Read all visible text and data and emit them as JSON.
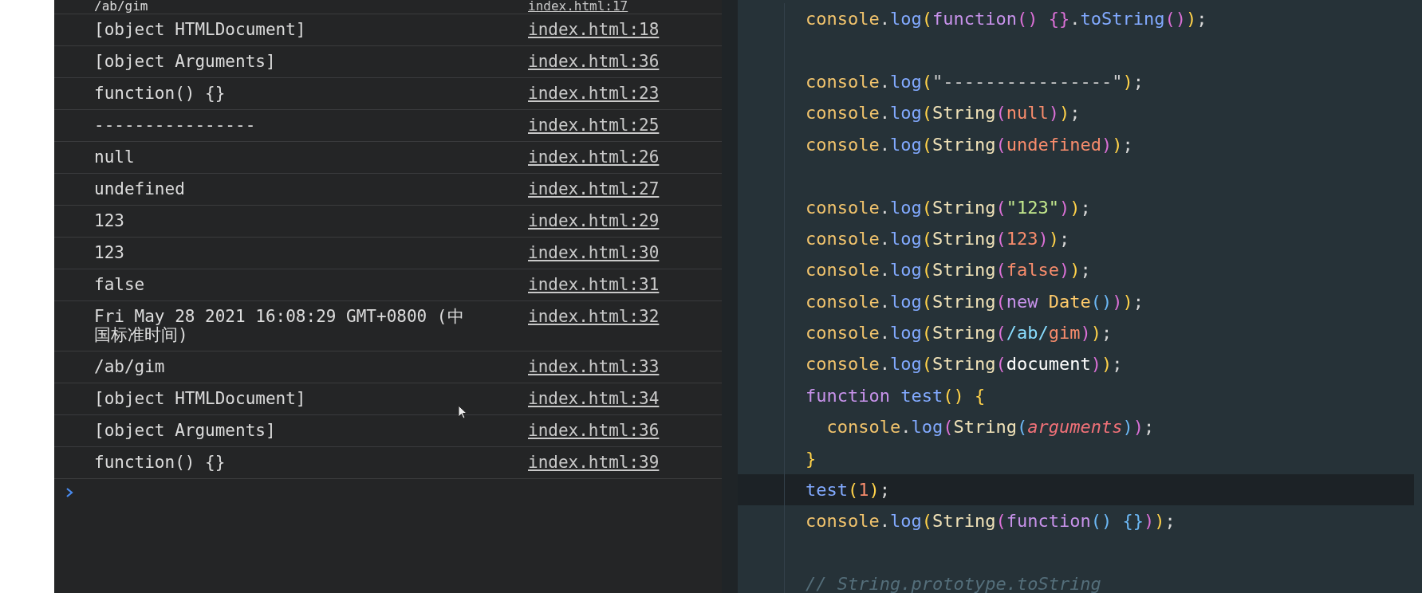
{
  "console": {
    "rows": [
      {
        "message": "/ab/gim",
        "source": "index.html:17"
      },
      {
        "message": "[object HTMLDocument]",
        "source": "index.html:18"
      },
      {
        "message": "[object Arguments]",
        "source": "index.html:36"
      },
      {
        "message": "function() {}",
        "source": "index.html:23"
      },
      {
        "message": "----------------",
        "source": "index.html:25"
      },
      {
        "message": "null",
        "source": "index.html:26"
      },
      {
        "message": "undefined",
        "source": "index.html:27"
      },
      {
        "message": "123",
        "source": "index.html:29"
      },
      {
        "message": "123",
        "source": "index.html:30"
      },
      {
        "message": "false",
        "source": "index.html:31"
      },
      {
        "message": "Fri May 28 2021 16:08:29 GMT+0800 (中国标准时间)",
        "source": "index.html:32"
      },
      {
        "message": "/ab/gim",
        "source": "index.html:33"
      },
      {
        "message": "[object HTMLDocument]",
        "source": "index.html:34"
      },
      {
        "message": "[object Arguments]",
        "source": "index.html:36"
      },
      {
        "message": "function() {}",
        "source": "index.html:39"
      }
    ]
  },
  "editor": {
    "lines": [
      {
        "kind": "code",
        "current": false,
        "tokens": [
          {
            "text": "console",
            "kind": "object"
          },
          {
            "text": ".",
            "kind": "punct"
          },
          {
            "text": "log",
            "kind": "method"
          },
          {
            "text": "(",
            "kind": "paren-gold"
          },
          {
            "text": "function",
            "kind": "keyword"
          },
          {
            "text": "()",
            "kind": "paren-pink"
          },
          {
            "text": " {}",
            "kind": "paren-pink"
          },
          {
            "text": ".",
            "kind": "punct"
          },
          {
            "text": "toString",
            "kind": "method"
          },
          {
            "text": "()",
            "kind": "paren-pink"
          },
          {
            "text": ")",
            "kind": "paren-gold"
          },
          {
            "text": ";",
            "kind": "punct"
          }
        ]
      },
      {
        "kind": "blank",
        "current": false
      },
      {
        "kind": "code",
        "current": false,
        "tokens": [
          {
            "text": "console",
            "kind": "object"
          },
          {
            "text": ".",
            "kind": "punct"
          },
          {
            "text": "log",
            "kind": "method"
          },
          {
            "text": "(",
            "kind": "paren-gold"
          },
          {
            "text": "\"----------------\"",
            "kind": "string"
          },
          {
            "text": ")",
            "kind": "paren-gold"
          },
          {
            "text": ";",
            "kind": "punct"
          }
        ]
      },
      {
        "kind": "code",
        "current": false,
        "tokens": [
          {
            "text": "console",
            "kind": "object"
          },
          {
            "text": ".",
            "kind": "punct"
          },
          {
            "text": "log",
            "kind": "method"
          },
          {
            "text": "(",
            "kind": "paren-gold"
          },
          {
            "text": "String",
            "kind": "builtin"
          },
          {
            "text": "(",
            "kind": "paren-pink"
          },
          {
            "text": "null",
            "kind": "literal"
          },
          {
            "text": ")",
            "kind": "paren-pink"
          },
          {
            "text": ")",
            "kind": "paren-gold"
          },
          {
            "text": ";",
            "kind": "punct"
          }
        ]
      },
      {
        "kind": "code",
        "current": false,
        "tokens": [
          {
            "text": "console",
            "kind": "object"
          },
          {
            "text": ".",
            "kind": "punct"
          },
          {
            "text": "log",
            "kind": "method"
          },
          {
            "text": "(",
            "kind": "paren-gold"
          },
          {
            "text": "String",
            "kind": "builtin"
          },
          {
            "text": "(",
            "kind": "paren-pink"
          },
          {
            "text": "undefined",
            "kind": "literal"
          },
          {
            "text": ")",
            "kind": "paren-pink"
          },
          {
            "text": ")",
            "kind": "paren-gold"
          },
          {
            "text": ";",
            "kind": "punct"
          }
        ]
      },
      {
        "kind": "blank",
        "current": false
      },
      {
        "kind": "code",
        "current": false,
        "tokens": [
          {
            "text": "console",
            "kind": "object"
          },
          {
            "text": ".",
            "kind": "punct"
          },
          {
            "text": "log",
            "kind": "method"
          },
          {
            "text": "(",
            "kind": "paren-gold"
          },
          {
            "text": "String",
            "kind": "builtin"
          },
          {
            "text": "(",
            "kind": "paren-pink"
          },
          {
            "text": "\"123\"",
            "kind": "string-green"
          },
          {
            "text": ")",
            "kind": "paren-pink"
          },
          {
            "text": ")",
            "kind": "paren-gold"
          },
          {
            "text": ";",
            "kind": "punct"
          }
        ]
      },
      {
        "kind": "code",
        "current": false,
        "tokens": [
          {
            "text": "console",
            "kind": "object"
          },
          {
            "text": ".",
            "kind": "punct"
          },
          {
            "text": "log",
            "kind": "method"
          },
          {
            "text": "(",
            "kind": "paren-gold"
          },
          {
            "text": "String",
            "kind": "builtin"
          },
          {
            "text": "(",
            "kind": "paren-pink"
          },
          {
            "text": "123",
            "kind": "literal"
          },
          {
            "text": ")",
            "kind": "paren-pink"
          },
          {
            "text": ")",
            "kind": "paren-gold"
          },
          {
            "text": ";",
            "kind": "punct"
          }
        ]
      },
      {
        "kind": "code",
        "current": false,
        "tokens": [
          {
            "text": "console",
            "kind": "object"
          },
          {
            "text": ".",
            "kind": "punct"
          },
          {
            "text": "log",
            "kind": "method"
          },
          {
            "text": "(",
            "kind": "paren-gold"
          },
          {
            "text": "String",
            "kind": "builtin"
          },
          {
            "text": "(",
            "kind": "paren-pink"
          },
          {
            "text": "false",
            "kind": "literal"
          },
          {
            "text": ")",
            "kind": "paren-pink"
          },
          {
            "text": ")",
            "kind": "paren-gold"
          },
          {
            "text": ";",
            "kind": "punct"
          }
        ]
      },
      {
        "kind": "code",
        "current": false,
        "tokens": [
          {
            "text": "console",
            "kind": "object"
          },
          {
            "text": ".",
            "kind": "punct"
          },
          {
            "text": "log",
            "kind": "method"
          },
          {
            "text": "(",
            "kind": "paren-gold"
          },
          {
            "text": "String",
            "kind": "builtin"
          },
          {
            "text": "(",
            "kind": "paren-pink"
          },
          {
            "text": "new",
            "kind": "keyword"
          },
          {
            "text": " Date",
            "kind": "class"
          },
          {
            "text": "()",
            "kind": "paren-blue"
          },
          {
            "text": ")",
            "kind": "paren-pink"
          },
          {
            "text": ")",
            "kind": "paren-gold"
          },
          {
            "text": ";",
            "kind": "punct"
          }
        ]
      },
      {
        "kind": "code",
        "current": false,
        "tokens": [
          {
            "text": "console",
            "kind": "object"
          },
          {
            "text": ".",
            "kind": "punct"
          },
          {
            "text": "log",
            "kind": "method"
          },
          {
            "text": "(",
            "kind": "paren-gold"
          },
          {
            "text": "String",
            "kind": "builtin"
          },
          {
            "text": "(",
            "kind": "paren-pink"
          },
          {
            "text": "/ab/",
            "kind": "regex"
          },
          {
            "text": "gim",
            "kind": "literal"
          },
          {
            "text": ")",
            "kind": "paren-pink"
          },
          {
            "text": ")",
            "kind": "paren-gold"
          },
          {
            "text": ";",
            "kind": "punct"
          }
        ]
      },
      {
        "kind": "code",
        "current": false,
        "tokens": [
          {
            "text": "console",
            "kind": "object"
          },
          {
            "text": ".",
            "kind": "punct"
          },
          {
            "text": "log",
            "kind": "method"
          },
          {
            "text": "(",
            "kind": "paren-gold"
          },
          {
            "text": "String",
            "kind": "builtin"
          },
          {
            "text": "(",
            "kind": "paren-pink"
          },
          {
            "text": "document",
            "kind": "variable"
          },
          {
            "text": ")",
            "kind": "paren-pink"
          },
          {
            "text": ")",
            "kind": "paren-gold"
          },
          {
            "text": ";",
            "kind": "punct"
          }
        ]
      },
      {
        "kind": "code",
        "current": false,
        "tokens": [
          {
            "text": "function",
            "kind": "keyword"
          },
          {
            "text": " test",
            "kind": "method"
          },
          {
            "text": "()",
            "kind": "paren-gold"
          },
          {
            "text": " {",
            "kind": "paren-gold"
          }
        ]
      },
      {
        "kind": "code",
        "current": false,
        "tokens": [
          {
            "text": "  console",
            "kind": "object"
          },
          {
            "text": ".",
            "kind": "punct"
          },
          {
            "text": "log",
            "kind": "method"
          },
          {
            "text": "(",
            "kind": "paren-pink"
          },
          {
            "text": "String",
            "kind": "builtin"
          },
          {
            "text": "(",
            "kind": "paren-blue"
          },
          {
            "text": "arguments",
            "kind": "param"
          },
          {
            "text": ")",
            "kind": "paren-blue"
          },
          {
            "text": ")",
            "kind": "paren-pink"
          },
          {
            "text": ";",
            "kind": "punct"
          }
        ]
      },
      {
        "kind": "code",
        "current": false,
        "tokens": [
          {
            "text": "}",
            "kind": "paren-gold"
          }
        ]
      },
      {
        "kind": "code",
        "current": true,
        "tokens": [
          {
            "text": "test",
            "kind": "method"
          },
          {
            "text": "(",
            "kind": "paren-gold"
          },
          {
            "text": "1",
            "kind": "literal"
          },
          {
            "text": ")",
            "kind": "paren-gold"
          },
          {
            "text": ";",
            "kind": "punct"
          }
        ]
      },
      {
        "kind": "code",
        "current": false,
        "tokens": [
          {
            "text": "console",
            "kind": "object"
          },
          {
            "text": ".",
            "kind": "punct"
          },
          {
            "text": "log",
            "kind": "method"
          },
          {
            "text": "(",
            "kind": "paren-gold"
          },
          {
            "text": "String",
            "kind": "builtin"
          },
          {
            "text": "(",
            "kind": "paren-pink"
          },
          {
            "text": "function",
            "kind": "keyword"
          },
          {
            "text": "()",
            "kind": "paren-blue"
          },
          {
            "text": " {}",
            "kind": "paren-blue"
          },
          {
            "text": ")",
            "kind": "paren-pink"
          },
          {
            "text": ")",
            "kind": "paren-gold"
          },
          {
            "text": ";",
            "kind": "punct"
          }
        ]
      },
      {
        "kind": "blank",
        "current": false
      },
      {
        "kind": "code",
        "current": false,
        "tokens": [
          {
            "text": "// String.prototype.toString",
            "kind": "comment"
          }
        ]
      }
    ]
  }
}
